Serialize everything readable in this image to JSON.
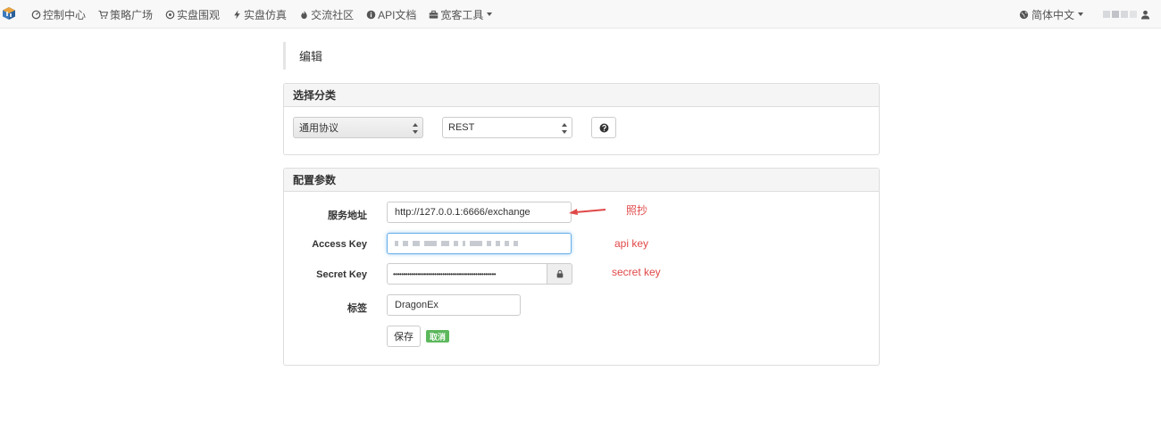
{
  "navbar": {
    "items": [
      {
        "label": "控制中心",
        "icon": "dashboard-icon"
      },
      {
        "label": "策略广场",
        "icon": "cart-icon"
      },
      {
        "label": "实盘围观",
        "icon": "play-circle-icon"
      },
      {
        "label": "实盘仿真",
        "icon": "bolt-icon"
      },
      {
        "label": "交流社区",
        "icon": "fire-icon"
      },
      {
        "label": "API文档",
        "icon": "info-circle-icon"
      },
      {
        "label": "宽客工具",
        "icon": "briefcase-icon"
      }
    ],
    "language": "简体中文"
  },
  "page": {
    "title": "编辑"
  },
  "category_panel": {
    "heading": "选择分类",
    "protocol_select": "通用协议",
    "type_select": "REST"
  },
  "config_panel": {
    "heading": "配置参数",
    "fields": {
      "server_address": {
        "label": "服务地址",
        "value": "http://127.0.0.1:6666/exchange"
      },
      "access_key": {
        "label": "Access Key"
      },
      "secret_key": {
        "label": "Secret Key",
        "value": "••••••••••••••••••••••••••••••••••••••••••••••••••"
      },
      "tag": {
        "label": "标签",
        "value": "DragonEx"
      }
    },
    "save_label": "保存",
    "cancel_label": "取消"
  },
  "annotations": {
    "server_note": "照抄",
    "access_note": "api key",
    "secret_note": "secret key"
  },
  "colors": {
    "success": "#5cb85c",
    "annotation": "#e04848",
    "focus": "#66afe9"
  }
}
